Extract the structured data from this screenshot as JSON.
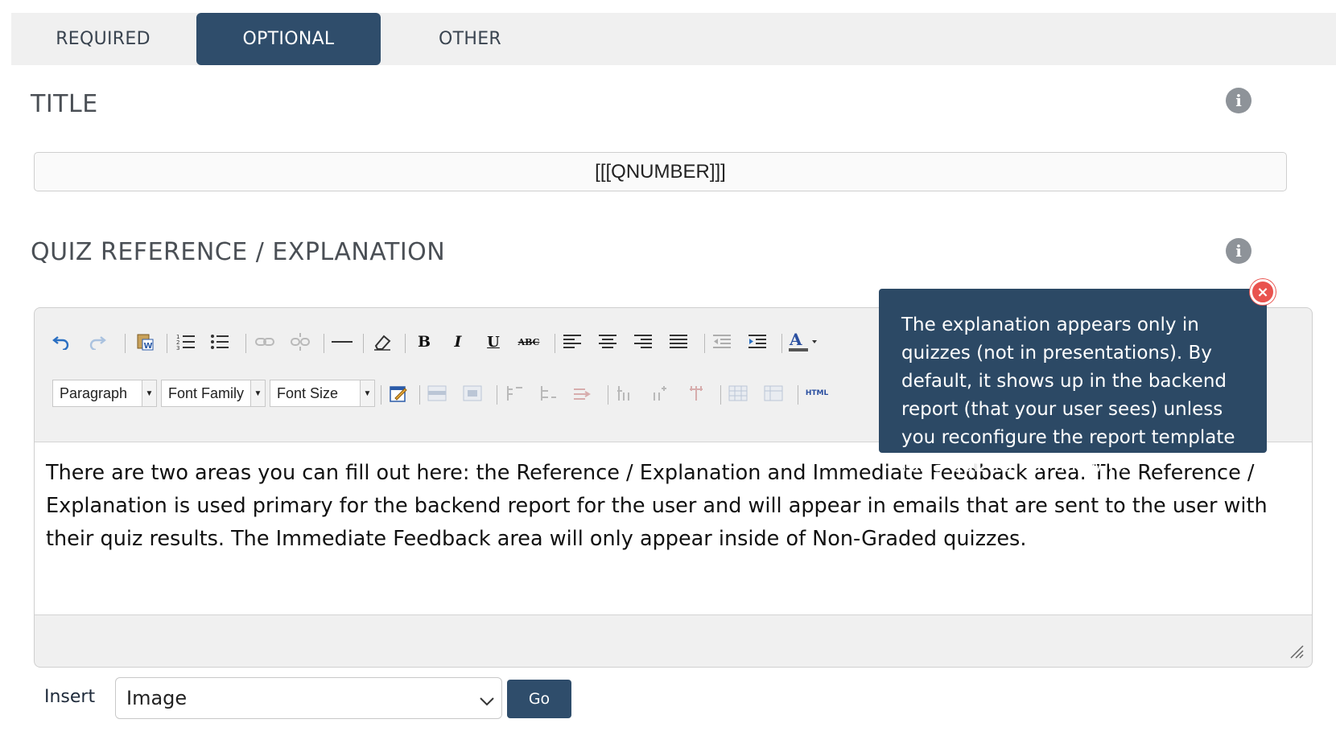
{
  "tabs": [
    {
      "label": "REQUIRED",
      "active": false
    },
    {
      "label": "OPTIONAL",
      "active": true
    },
    {
      "label": "OTHER",
      "active": false
    }
  ],
  "title_section": {
    "heading": "TITLE",
    "input_value": "[[[QNUMBER]]]",
    "info_icon": "info-icon"
  },
  "explanation_section": {
    "heading": "QUIZ REFERENCE / EXPLANATION",
    "info_icon": "info-icon"
  },
  "editor": {
    "toolbar_row1": [
      "undo-icon",
      "redo-icon",
      "paste-word-icon",
      "numbered-list-icon",
      "bullet-list-icon",
      "link-icon",
      "unlink-icon",
      "horizontal-rule-icon",
      "eraser-icon",
      "bold-icon",
      "italic-icon",
      "underline-icon",
      "strikethrough-icon",
      "align-left-icon",
      "align-center-icon",
      "align-right-icon",
      "justify-icon",
      "outdent-icon",
      "indent-icon",
      "font-color-icon"
    ],
    "toolbar_row2": [
      "edit-icon",
      "row-above-icon",
      "row-below-icon",
      "col-before-icon",
      "col-after-icon",
      "split-icon",
      "merge-icon",
      "insert-row-icon",
      "delete-row-icon",
      "table-icon",
      "table-props-icon",
      "html-icon"
    ],
    "format_select": "Paragraph",
    "font_family_select": "Font Family",
    "font_size_select": "Font Size",
    "html_label": "HTML",
    "content": "There are two areas you can fill out here: the Reference / Explanation and Immediate Feedback area. The Reference / Explanation is used primary for the backend report for the user and will appear in emails that are sent to the user with their quiz results. The Immediate Feedback area will only appear inside of Non-Graded quizzes."
  },
  "insert": {
    "label": "Insert",
    "selected": "Image",
    "go_label": "Go"
  },
  "tooltip": {
    "text": "The explanation appears only in quizzes (not in presentations). By default, it shows up in the backend report (that your user sees) unless you reconfigure the report template for a quiz to not show it.",
    "close_symbol": "×"
  },
  "colors": {
    "accent": "#2f4d6b",
    "tooltip_bg": "#2c4965",
    "close_red": "#e9534f",
    "tabbar_bg": "#f0f0f0"
  }
}
